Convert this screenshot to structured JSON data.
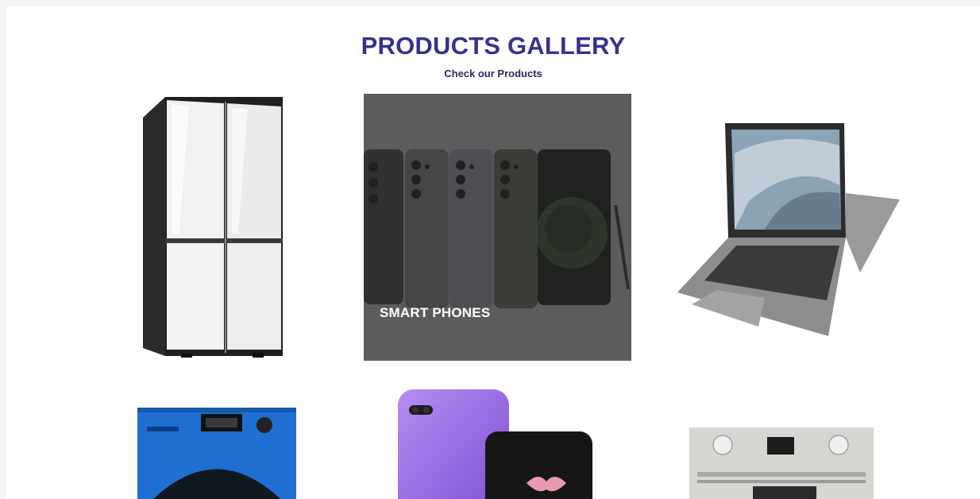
{
  "gallery": {
    "title": "PRODUCTS GALLERY",
    "subtitle": "Check our Products"
  },
  "products": [
    {
      "id": "refrigerator",
      "icon": "refrigerator-image",
      "label": ""
    },
    {
      "id": "smart-phones",
      "icon": "smartphones-image",
      "label": "SMART PHONES",
      "hovered": true
    },
    {
      "id": "laptop",
      "icon": "laptop-image",
      "label": ""
    },
    {
      "id": "washing-machine",
      "icon": "washing-machine-image",
      "label": ""
    },
    {
      "id": "foldable-phone",
      "icon": "foldable-phone-image",
      "label": ""
    },
    {
      "id": "oven",
      "icon": "oven-image",
      "label": ""
    }
  ],
  "colors": {
    "title": "#35338c",
    "overlay": "#6b6b6b",
    "washer_blue": "#1f6fd1",
    "phone_purple": "#9b6fe0"
  }
}
